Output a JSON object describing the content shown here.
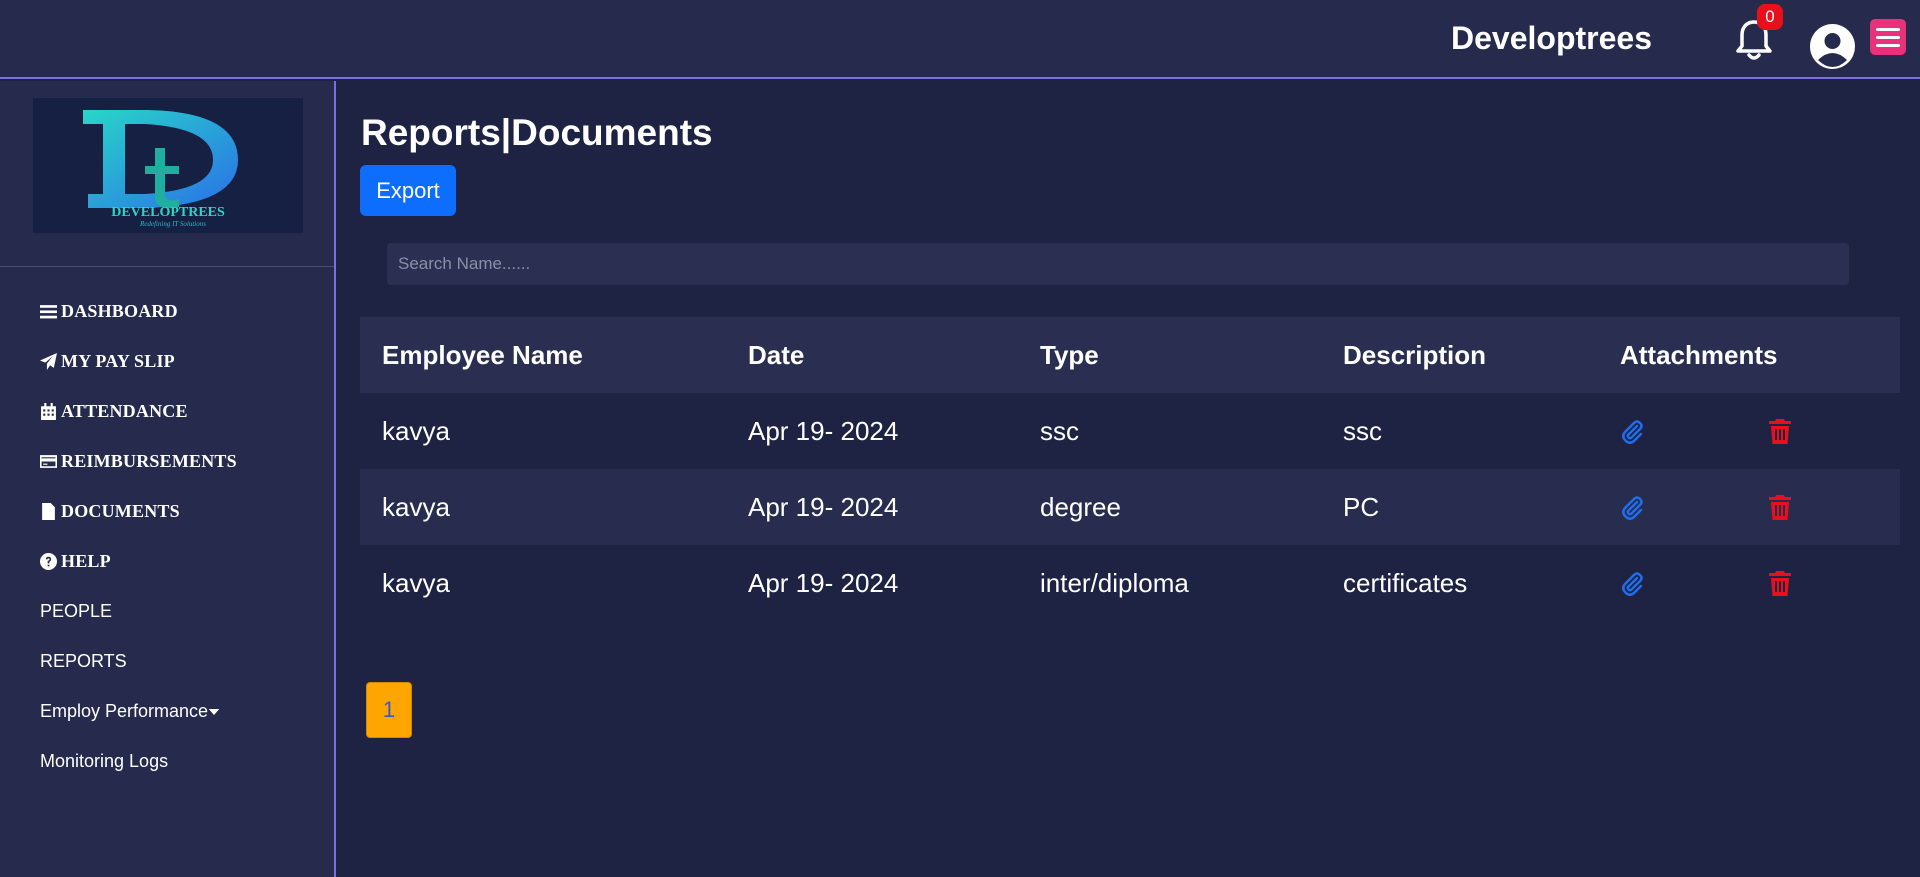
{
  "header": {
    "brand": "Developtrees",
    "notification_count": "0"
  },
  "sidebar": {
    "logo_text": "DEVELOPTREES",
    "logo_tagline": "Redefining IT Solutions",
    "items": [
      {
        "label": "DASHBOARD",
        "icon": "bars-icon"
      },
      {
        "label": "MY PAY SLIP",
        "icon": "paper-plane-icon"
      },
      {
        "label": "ATTENDANCE",
        "icon": "calendar-icon"
      },
      {
        "label": "REIMBURSEMENTS",
        "icon": "credit-card-icon"
      },
      {
        "label": "DOCUMENTS",
        "icon": "file-icon"
      },
      {
        "label": "HELP",
        "icon": "question-circle-icon"
      },
      {
        "label": "PEOPLE"
      },
      {
        "label": "REPORTS"
      },
      {
        "label": "Employ Performance",
        "icon": "caret-down-icon"
      },
      {
        "label": "Monitoring Logs"
      }
    ]
  },
  "main": {
    "title": "Reports|Documents",
    "export_label": "Export",
    "search_placeholder": "Search Name......",
    "table": {
      "headers": [
        "Employee Name",
        "Date",
        "Type",
        "Description",
        "Attachments"
      ],
      "rows": [
        {
          "name": "kavya",
          "date": "Apr 19- 2024",
          "type": "ssc",
          "description": "ssc"
        },
        {
          "name": "kavya",
          "date": "Apr 19- 2024",
          "type": "degree",
          "description": "PC"
        },
        {
          "name": "kavya",
          "date": "Apr 19- 2024",
          "type": "inter/diploma",
          "description": "certificates"
        }
      ]
    },
    "pagination": {
      "current_page": "1"
    }
  },
  "colors": {
    "background": "#1f2343",
    "panel": "#262b4d",
    "accent_border": "#7b6ee0",
    "export_button": "#0d6efd",
    "delete_icon": "#e8101a",
    "attachment_icon": "#1e6ff0",
    "menu_button": "#e8317a",
    "page_button": "#ffa500"
  }
}
